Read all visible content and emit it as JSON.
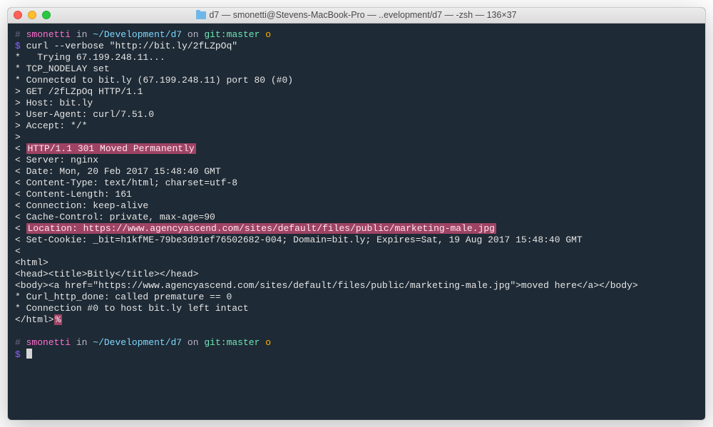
{
  "window": {
    "title": "d7 — smonetti@Stevens-MacBook-Pro — ..evelopment/d7 — -zsh — 136×37"
  },
  "prompt1": {
    "hash": "#",
    "user": "smonetti",
    "in": "in",
    "path": "~/Development/d7",
    "on": "on",
    "git": "git:",
    "branch": "master",
    "dirty": "o",
    "sym": "$",
    "cmd": "curl --verbose \"http://bit.ly/2fLZpOq\""
  },
  "out": {
    "l01": "*   Trying 67.199.248.11...",
    "l02": "* TCP_NODELAY set",
    "l03": "* Connected to bit.ly (67.199.248.11) port 80 (#0)",
    "l04": "> GET /2fLZpOq HTTP/1.1",
    "l05": "> Host: bit.ly",
    "l06": "> User-Agent: curl/7.51.0",
    "l07": "> Accept: */*",
    "l08": ">",
    "l09a": "< ",
    "l09b": "HTTP/1.1 301 Moved Permanently",
    "l10": "< Server: nginx",
    "l11": "< Date: Mon, 20 Feb 2017 15:48:40 GMT",
    "l12": "< Content-Type: text/html; charset=utf-8",
    "l13": "< Content-Length: 161",
    "l14": "< Connection: keep-alive",
    "l15": "< Cache-Control: private, max-age=90",
    "l16a": "< ",
    "l16b": "Location: https://www.agencyascend.com/sites/default/files/public/marketing-male.jpg",
    "l17": "< Set-Cookie: _bit=h1kfME-79be3d91ef76502682-004; Domain=bit.ly; Expires=Sat, 19 Aug 2017 15:48:40 GMT",
    "l18": "<",
    "l19": "<html>",
    "l20": "<head><title>Bitly</title></head>",
    "l21": "<body><a href=\"https://www.agencyascend.com/sites/default/files/public/marketing-male.jpg\">moved here</a></body>",
    "l22": "* Curl_http_done: called premature == 0",
    "l23": "* Connection #0 to host bit.ly left intact",
    "l24a": "</html>",
    "l24b": "%"
  },
  "prompt2": {
    "hash": "#",
    "user": "smonetti",
    "in": "in",
    "path": "~/Development/d7",
    "on": "on",
    "git": "git:",
    "branch": "master",
    "dirty": "o",
    "sym": "$"
  }
}
